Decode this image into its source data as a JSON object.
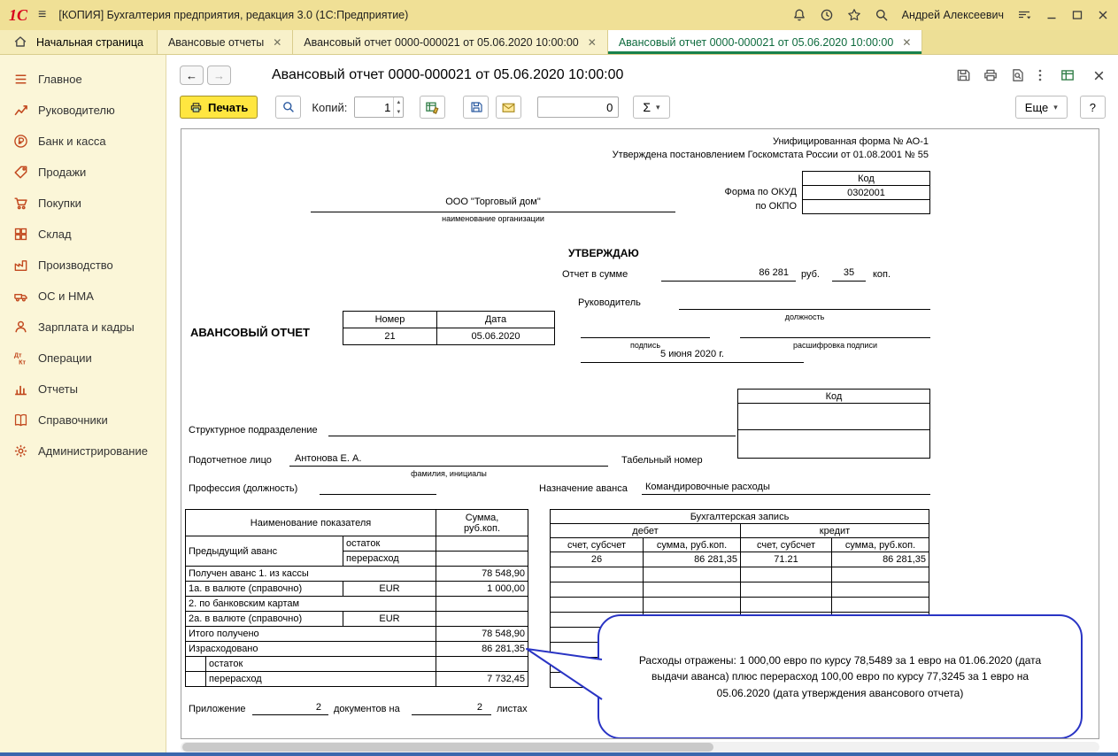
{
  "titlebar": {
    "logo": "1С",
    "title": "[КОПИЯ] Бухгалтерия предприятия, редакция 3.0  (1С:Предприятие)",
    "user": "Андрей Алексеевич"
  },
  "tabbar": {
    "home": "Начальная страница",
    "tabs": [
      {
        "label": "Авансовые отчеты"
      },
      {
        "label": "Авансовый отчет 0000-000021 от 05.06.2020 10:00:00"
      },
      {
        "label": "Авансовый отчет 0000-000021 от 05.06.2020 10:00:00"
      }
    ]
  },
  "sidebar": {
    "items": [
      {
        "label": "Главное"
      },
      {
        "label": "Руководителю"
      },
      {
        "label": "Банк и касса"
      },
      {
        "label": "Продажи"
      },
      {
        "label": "Покупки"
      },
      {
        "label": "Склад"
      },
      {
        "label": "Производство"
      },
      {
        "label": "ОС и НМА"
      },
      {
        "label": "Зарплата и кадры"
      },
      {
        "label": "Операции"
      },
      {
        "label": "Отчеты"
      },
      {
        "label": "Справочники"
      },
      {
        "label": "Администрирование"
      }
    ]
  },
  "main": {
    "title": "Авансовый отчет 0000-000021 от 05.06.2020 10:00:00",
    "toolbar": {
      "print": "Печать",
      "copies_label": "Копий:",
      "copies_value": "1",
      "counter_value": "0",
      "sigma": "Σ",
      "more": "Еще",
      "help": "?"
    }
  },
  "icons": {
    "search-icon": "magnifier",
    "bell-icon": "bell",
    "history-icon": "clock",
    "favorites-icon": "star",
    "minimize-icon": "—",
    "maximize-icon": "□",
    "close-icon": "✕",
    "home-icon": "house",
    "print-icon": "printer",
    "save-icon": "diskette",
    "email-icon": "envelope",
    "more-dots-icon": "⋮",
    "sum-icon": "Σ"
  },
  "form": {
    "note1": "Унифицированная форма № АО-1",
    "note2": "Утверждена постановлением Госкомстата России от  01.08.2001 № 55",
    "code_label": "Код",
    "okud_label": "Форма по ОКУД",
    "okud_value": "0302001",
    "okpo_label": "по ОКПО",
    "org_value": "ООО \"Торговый дом\"",
    "org_caption": "наименование организации",
    "approve": "УТВЕРЖДАЮ",
    "sum_label": "Отчет в сумме",
    "sum_rub": "86 281",
    "rub": "руб.",
    "sum_kop": "35",
    "kop": "коп.",
    "manager_label": "Руководитель",
    "position_caption": "должность",
    "sign_caption": "подпись",
    "sign_name_caption": "расшифровка подписи",
    "approve_date": "5 июня 2020 г.",
    "doc_title": "АВАНСОВЫЙ ОТЧЕТ",
    "num_header": "Номер",
    "num_value": "21",
    "date_header": "Дата",
    "date_value": "05.06.2020",
    "code2_label": "Код",
    "dept_label": "Структурное подразделение",
    "person_label": "Подотчетное лицо",
    "person_value": "Антонова Е. А.",
    "person_caption": "фамилия, инициалы",
    "personnel_label": "Табельный номер",
    "prof_label": "Профессия (должность)",
    "purpose_label": "Назначение аванса",
    "purpose_value": "Командировочные расходы",
    "adv": {
      "h_name": "Наименование показателя",
      "h_sum1": "Сумма,",
      "h_sum2": "руб.коп.",
      "prev": "Предыдущий аванс",
      "prev_rest": "остаток",
      "prev_over": "перерасход",
      "r1_name": "Получен аванс 1. из кассы",
      "r1_sum": "78 548,90",
      "r2_name": "1а. в валюте (справочно)",
      "r2_cur": "EUR",
      "r2_sum": "1 000,00",
      "r3_name": "2. по банковским картам",
      "r4_name": "2а. в валюте (справочно)",
      "r4_cur": "EUR",
      "r5_name": "Итого получено",
      "r5_sum": "78 548,90",
      "r6_name": "Израсходовано",
      "r6_sum": "86 281,35",
      "r7_name": "остаток",
      "r8_name": "перерасход",
      "r8_sum": "7 732,45"
    },
    "acc": {
      "title": "Бухгалтерская запись",
      "debit": "дебет",
      "credit": "кредит",
      "h_account": "счет, субсчет",
      "h_sum": "сумма, руб.коп.",
      "d_account": "26",
      "d_sum": "86 281,35",
      "c_account": "71.21",
      "c_sum": "86 281,35"
    },
    "callout_text": "Расходы отражены: 1 000,00 евро  по курсу 78,5489 за 1 евро на 01.06.2020 (дата выдачи аванса) плюс перерасход 100,00 евро по курсу 77,3245 за 1 евро на 05.06.2020 (дата утверждения авансового отчета)",
    "appendix_label": "Приложение",
    "appendix_docs": "2",
    "appendix_docs_label": "документов на",
    "appendix_sheets": "2",
    "appendix_sheets_label": "листах"
  }
}
